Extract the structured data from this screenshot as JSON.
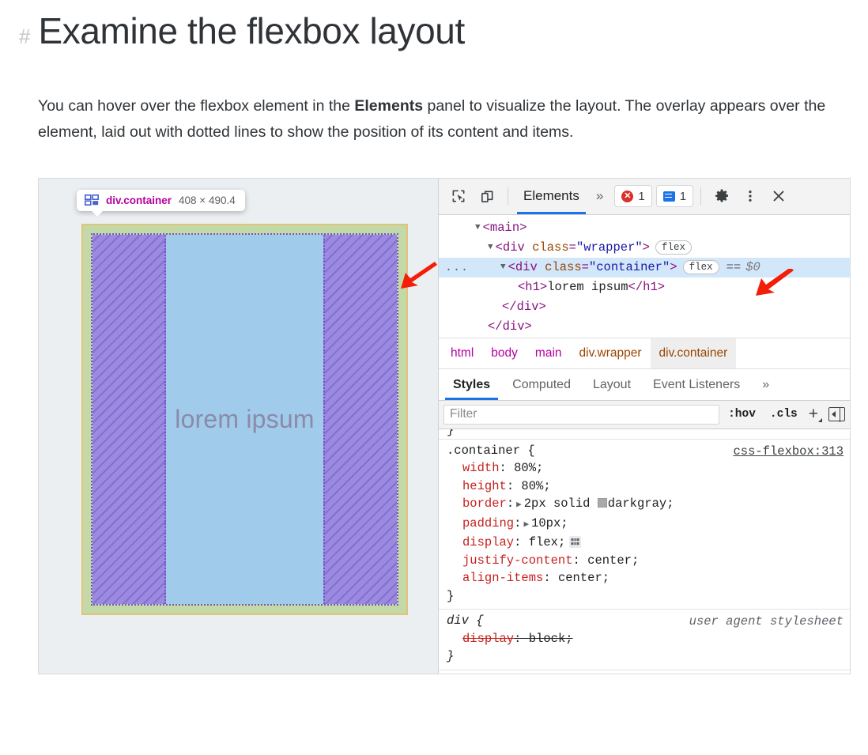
{
  "article": {
    "anchor": "#",
    "heading": "Examine the flexbox layout",
    "paragraph_part1": "You can hover over the flexbox element in the ",
    "paragraph_bold": "Elements",
    "paragraph_part2": " panel to visualize the layout. The overlay appears over the element, laid out with dotted lines to show the position of its content and items."
  },
  "viewport": {
    "highlight_badge": {
      "icon": "flexbox-icon",
      "element_name": "div.container",
      "dimensions": "408 × 490.4"
    },
    "item_text": "lorem ipsum",
    "colors": {
      "padding": "#c3d9a8",
      "border": "#e3c37a",
      "free_space": "#9a8ae0",
      "content_item": "#a0cbeb",
      "dotted_line": "#7a52c7"
    }
  },
  "devtools": {
    "toolbar": {
      "inspect_icon": "inspect-element-icon",
      "device_icon": "device-toolbar-icon",
      "active_panel": "Elements",
      "more_panels": "»",
      "error_count": "1",
      "message_count": "1",
      "settings_icon": "gear-icon",
      "menu_icon": "vertical-dots-icon",
      "close_icon": "close-icon"
    },
    "dom_tree": [
      {
        "indent": 1,
        "triangle": "▼",
        "text": "<main>",
        "kind": "tag"
      },
      {
        "indent": 2,
        "triangle": "▼",
        "text": "<div class=\"wrapper\">",
        "badge": "flex"
      },
      {
        "indent": 3,
        "triangle": "▼",
        "text": "<div class=\"container\">",
        "badge": "flex",
        "equals": "==",
        "dollar": "$0",
        "selected": true,
        "ellipsis": "..."
      },
      {
        "indent": 4,
        "triangle": "",
        "text": "<h1>lorem ipsum</h1>"
      },
      {
        "indent": 5,
        "triangle": "",
        "text": "</div>"
      },
      {
        "indent": 6,
        "triangle": "",
        "text": "</div>"
      }
    ],
    "breadcrumbs": [
      "html",
      "body",
      "main",
      "div.wrapper",
      "div.container"
    ],
    "style_tabs": [
      "Styles",
      "Computed",
      "Layout",
      "Event Listeners"
    ],
    "style_tabs_overflow": "»",
    "filter": {
      "placeholder": "Filter",
      "value": "",
      "hov_label": ":hov",
      "cls_label": ".cls",
      "new_rule_label": "+",
      "sidebar_toggle": "sidebar-toggle-icon"
    },
    "rules": [
      {
        "partial": true,
        "lines": [
          {
            "text": "}"
          }
        ]
      },
      {
        "selector": ".container {",
        "origin": "css-flexbox:313",
        "declarations": [
          {
            "prop": "width",
            "value": "80%",
            "expand": false
          },
          {
            "prop": "height",
            "value": "80%",
            "expand": false
          },
          {
            "prop": "border",
            "value": "2px solid darkgray",
            "expand": true,
            "swatch": "#a9a9a9"
          },
          {
            "prop": "padding",
            "value": "10px",
            "expand": true
          },
          {
            "prop": "display",
            "value": "flex",
            "expand": false,
            "editor_icon": "flexbox-editor-icon"
          },
          {
            "prop": "justify-content",
            "value": "center",
            "expand": false
          },
          {
            "prop": "align-items",
            "value": "center",
            "expand": false
          }
        ],
        "close": "}"
      },
      {
        "selector": "div {",
        "origin": "user agent stylesheet",
        "origin_ua": true,
        "italic": true,
        "declarations": [
          {
            "prop": "display",
            "value": "block",
            "struck": true
          }
        ],
        "close": "}"
      }
    ]
  },
  "annotations": {
    "arrow_left": "red-arrow-icon",
    "arrow_right": "red-arrow-icon",
    "arrow_color": "#f31e08"
  }
}
